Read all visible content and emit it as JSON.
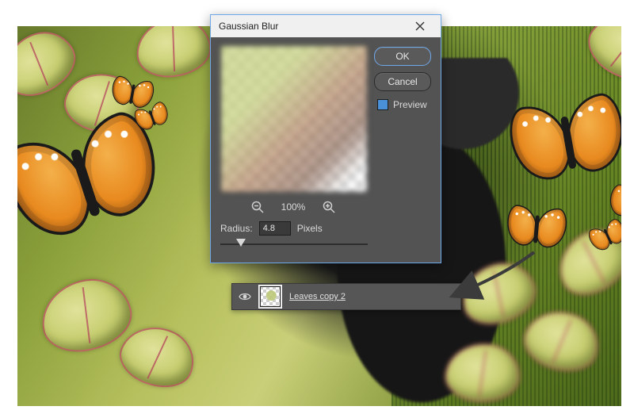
{
  "dialog": {
    "title": "Gaussian Blur",
    "ok_label": "OK",
    "cancel_label": "Cancel",
    "preview_label": "Preview",
    "preview_checked": true,
    "zoom_label": "100%",
    "radius_label": "Radius:",
    "radius_value": "4.8",
    "radius_unit": "Pixels",
    "slider_percent": 14
  },
  "layer": {
    "name": "Leaves copy 2",
    "visible": true
  }
}
